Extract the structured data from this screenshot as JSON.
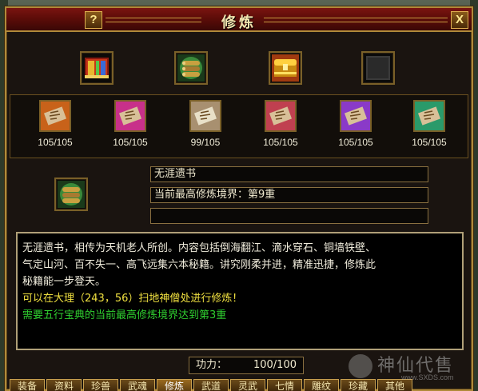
{
  "window": {
    "title": "修炼",
    "help_label": "?",
    "close_label": "X"
  },
  "top_slots": [
    {
      "name": "book-red-icon",
      "colors": [
        "#b03018",
        "#e8b830"
      ]
    },
    {
      "name": "scroll-green-bundle-icon",
      "colors": [
        "#2a7a2a",
        "#c8a040"
      ]
    },
    {
      "name": "gold-chest-icon",
      "colors": [
        "#c88a10",
        "#ffe060"
      ]
    },
    {
      "name": "empty-slot",
      "colors": [
        "#2a2a2a",
        "#3a3a3a"
      ]
    }
  ],
  "scrolls": [
    {
      "count": "105/105",
      "color": "#c8621a"
    },
    {
      "count": "105/105",
      "color": "#c8308a"
    },
    {
      "count": "99/105",
      "color": "#a89070"
    },
    {
      "count": "105/105",
      "color": "#c04050"
    },
    {
      "count": "105/105",
      "color": "#8a3ac8"
    },
    {
      "count": "105/105",
      "color": "#2a9a6a"
    }
  ],
  "info": {
    "book_name": "无涯遗书",
    "level_text": "当前最高修炼境界：第9重",
    "empty_field": ""
  },
  "description": {
    "line1": "无涯遗书，相传为天机老人所创。内容包括倒海翻江、滴水穿石、铜墙铁壁、",
    "line2": "气定山河、百不失一、高飞远集六本秘籍。讲究刚柔并进，精准迅捷，修炼此",
    "line3": "秘籍能一步登天。",
    "yellow": "可以在大理（243，56）扫地神僧处进行修炼！",
    "green": "需要五行宝典的当前最高修炼境界达到第3重"
  },
  "power": {
    "label": "功力：",
    "value": "100/100"
  },
  "tabs": [
    "装备",
    "资料",
    "珍兽",
    "武魂",
    "修炼",
    "武道",
    "灵武",
    "七情",
    "雕纹",
    "珍藏",
    "其他"
  ],
  "active_tab": "修炼",
  "watermark": {
    "text": "神仙代售",
    "url": "www.SXDS.com"
  }
}
